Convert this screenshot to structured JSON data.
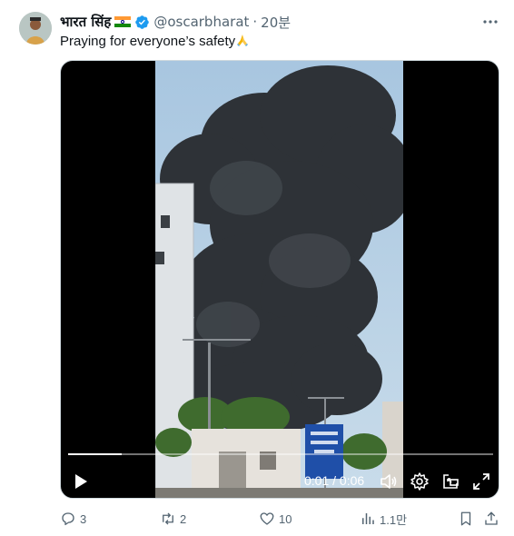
{
  "author": {
    "display_name": "भारत सिंह",
    "flag_icon": "india-flag-icon",
    "verified_icon": "verified-badge-icon",
    "handle": "@oscarbharat",
    "separator": "·",
    "timestamp": "20분"
  },
  "tweet": {
    "text": "Praying for everyone’s safety",
    "emoji_icon": "folded-hands-icon"
  },
  "video": {
    "current_time": "0:01",
    "time_separator": " / ",
    "duration": "0:06",
    "progress": 0.125,
    "controls": [
      "play-icon",
      "volume-icon",
      "settings-icon",
      "picture-in-picture-icon",
      "fullscreen-icon"
    ]
  },
  "actions": {
    "replies": "3",
    "reposts": "2",
    "likes": "10",
    "views": "1.1만"
  },
  "colors": {
    "text_primary": "#0f1419",
    "text_secondary": "#536471",
    "verified": "#1d9bf0",
    "media_border": "#cfd9de"
  }
}
